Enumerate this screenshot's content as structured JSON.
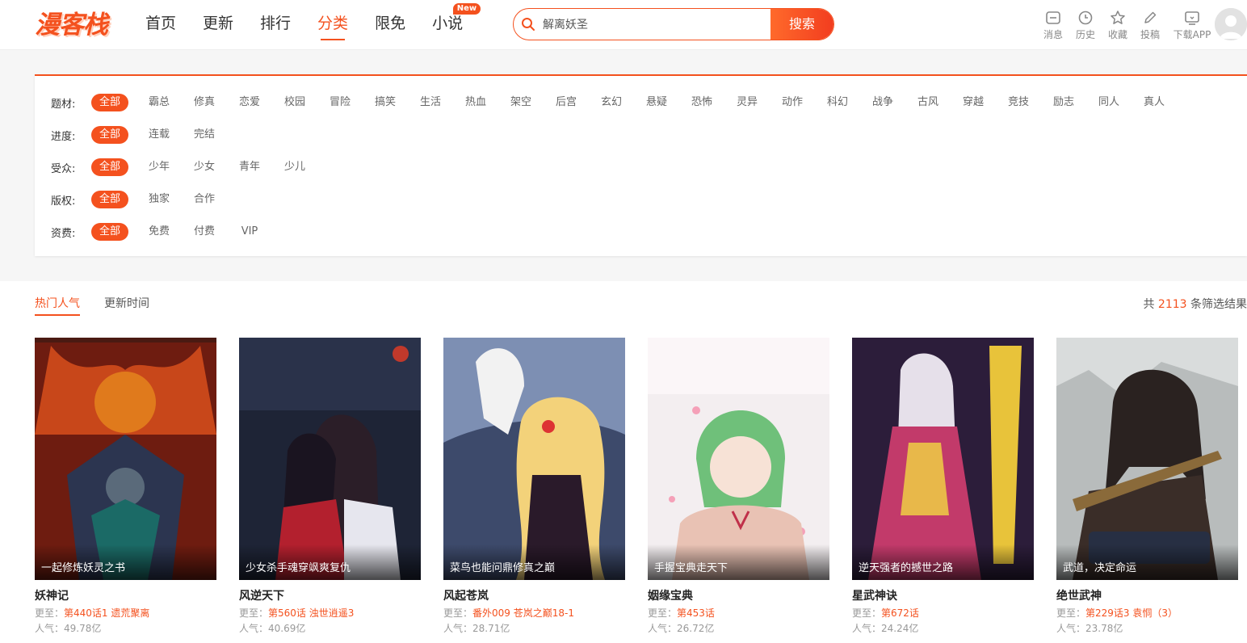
{
  "header": {
    "logo_text": "漫客栈",
    "nav": [
      "首页",
      "更新",
      "排行",
      "分类",
      "限免",
      "小说"
    ],
    "nav_active_index": 3,
    "new_badge": "New",
    "search": {
      "value": "解离妖圣",
      "button": "搜索"
    },
    "tools": [
      {
        "label": "消息",
        "icon": "message-icon"
      },
      {
        "label": "历史",
        "icon": "history-icon"
      },
      {
        "label": "收藏",
        "icon": "star-icon"
      },
      {
        "label": "投稿",
        "icon": "pencil-icon"
      },
      {
        "label": "下载APP",
        "icon": "tv-icon"
      }
    ]
  },
  "filters": [
    {
      "label": "题材:",
      "options": [
        "全部",
        "霸总",
        "修真",
        "恋爱",
        "校园",
        "冒险",
        "搞笑",
        "生活",
        "热血",
        "架空",
        "后宫",
        "玄幻",
        "悬疑",
        "恐怖",
        "灵异",
        "动作",
        "科幻",
        "战争",
        "古风",
        "穿越",
        "竞技",
        "励志",
        "同人",
        "真人"
      ]
    },
    {
      "label": "进度:",
      "options": [
        "全部",
        "连载",
        "完结"
      ]
    },
    {
      "label": "受众:",
      "options": [
        "全部",
        "少年",
        "少女",
        "青年",
        "少儿"
      ]
    },
    {
      "label": "版权:",
      "options": [
        "全部",
        "独家",
        "合作"
      ]
    },
    {
      "label": "资费:",
      "options": [
        "全部",
        "免费",
        "付费",
        "VIP"
      ]
    }
  ],
  "sort": {
    "tabs": [
      "热门人气",
      "更新时间"
    ],
    "active_index": 0
  },
  "result_count": {
    "prefix": "共 ",
    "number": "2113",
    "suffix": " 条筛选结果"
  },
  "comics": [
    {
      "title": "妖神记",
      "desc": "一起修炼妖灵之书",
      "update_prefix": "更至：",
      "chapter": "第440话1 遗荒聚离",
      "popularity": "人气：49.78亿"
    },
    {
      "title": "风逆天下",
      "desc": "少女杀手魂穿飒爽复仇",
      "update_prefix": "更至：",
      "chapter": "第560话 浊世逍遥3",
      "popularity": "人气：40.69亿"
    },
    {
      "title": "风起苍岚",
      "desc": "菜鸟也能问鼎修真之巅",
      "update_prefix": "更至：",
      "chapter": "番外009 苍岚之巅18-1",
      "popularity": "人气：28.71亿"
    },
    {
      "title": "姻缘宝典",
      "desc": "手握宝典走天下",
      "update_prefix": "更至：",
      "chapter": "第453话",
      "popularity": "人气：26.72亿"
    },
    {
      "title": "星武神诀",
      "desc": "逆天强者的撼世之路",
      "update_prefix": "更至：",
      "chapter": "第672话",
      "popularity": "人气：24.24亿"
    },
    {
      "title": "绝世武神",
      "desc": "武道，决定命运",
      "update_prefix": "更至：",
      "chapter": "第229话3 袁恫（3）",
      "popularity": "人气：23.78亿"
    }
  ],
  "colors": {
    "accent": "#f4511e"
  }
}
